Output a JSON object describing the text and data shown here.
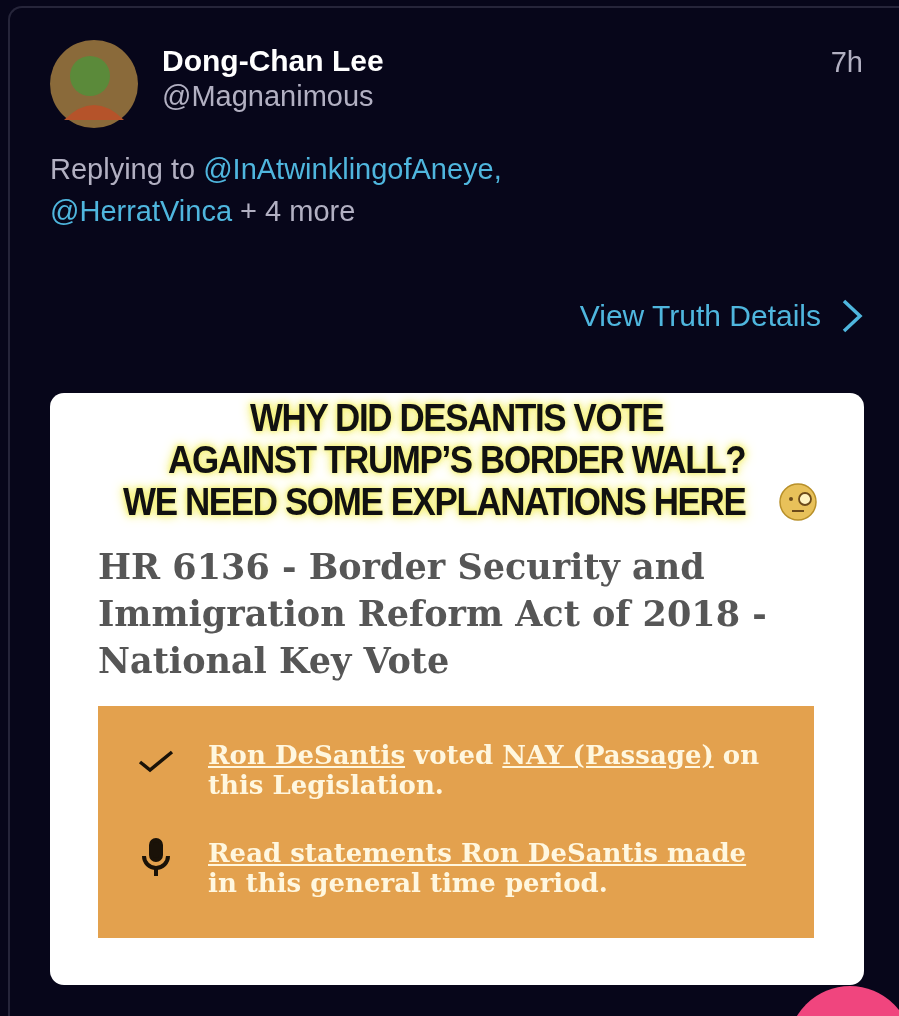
{
  "post": {
    "author": "Dong-Chan Lee",
    "handle": "@Magnanimous",
    "time": "7h",
    "replying": {
      "prefix": "Replying to",
      "mentions": [
        "@InAtwinklingofAneye,",
        "@HerratVinca"
      ],
      "more": "+ 4 more"
    },
    "details_link": "View Truth Details",
    "image": {
      "headline": [
        "WHY DID DESANTIS VOTE",
        "AGAINST TRUMP’S BORDER WALL?",
        "WE NEED SOME EXPLANATIONS HERE"
      ],
      "bill_title": "HR 6136 - Border Security and Immigration Reform Act of 2018 - National Key Vote",
      "rows": [
        {
          "kind": "check",
          "parts": [
            {
              "text": "Ron DeSantis",
              "link": true
            },
            {
              "text": " voted ",
              "link": false
            },
            {
              "text": "NAY (Passage)",
              "link": true
            },
            {
              "text": " on this Legislation.",
              "link": false
            }
          ]
        },
        {
          "kind": "mic",
          "parts": [
            {
              "text": "Read statements Ron DeSantis made",
              "link": true
            },
            {
              "text": " in this general time period.",
              "link": false
            }
          ]
        }
      ]
    }
  }
}
